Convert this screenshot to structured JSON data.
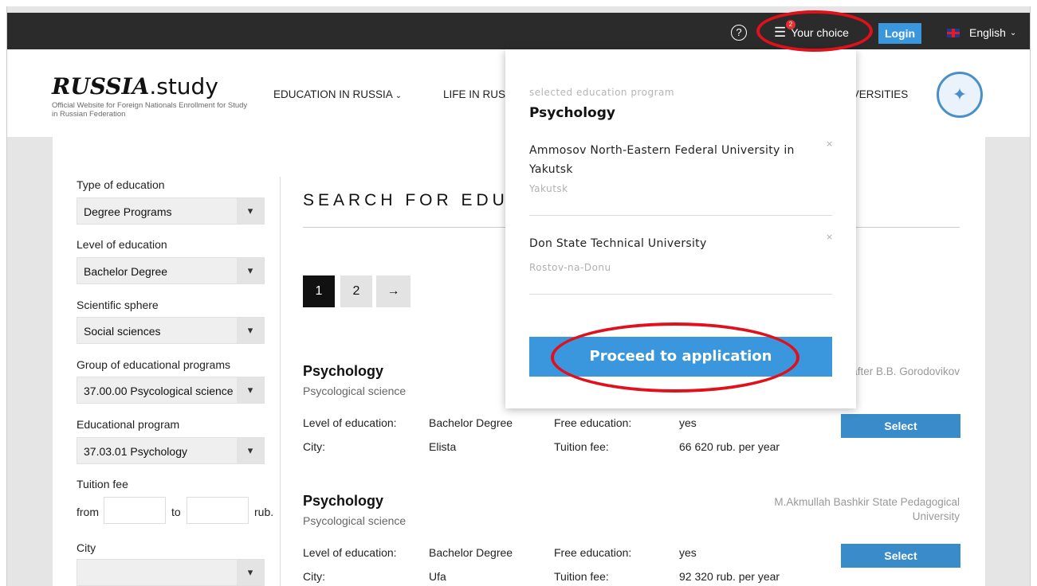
{
  "topbar": {
    "help_icon": "?",
    "choice_label": "Your choice",
    "choice_badge": "2",
    "login_label": "Login",
    "language_label": "English",
    "colors": {
      "bar": "#2b2b2b",
      "login": "#3a96dd",
      "highlight": "#e0111b"
    }
  },
  "header": {
    "logo_text": ".study",
    "logo_mark": "RUSSIA",
    "logo_subtitle": "Official Website for Foreign Nationals Enrollment for Study in Russian Federation",
    "nav": [
      "EDUCATION IN RUSSIA",
      "LIFE IN RUSS",
      "IVERSITIES"
    ]
  },
  "filters": {
    "type_label": "Type of education",
    "type_value": "Degree Programs",
    "level_label": "Level of education",
    "level_value": "Bachelor Degree",
    "sphere_label": "Scientific sphere",
    "sphere_value": "Social sciences",
    "group_label": "Group of educational programs",
    "group_value": "37.00.00 Psycological science",
    "program_label": "Educational program",
    "program_value": "37.03.01 Psychology",
    "fee_label": "Tuition fee",
    "fee_from": "from",
    "fee_to": "to",
    "fee_unit": "rub.",
    "city_label": "City",
    "city_value": ""
  },
  "main": {
    "title": "SEARCH FOR EDU",
    "pages": [
      "1",
      "2"
    ],
    "next_arrow": "→",
    "results": [
      {
        "title": "Psychology",
        "subtitle": "Psycological science",
        "university": "rsity named after B.B. Gorodovikov",
        "level_label": "Level of education:",
        "level_value": "Bachelor Degree",
        "free_label": "Free education:",
        "free_value": "yes",
        "city_label": "City:",
        "city_value": "Elista",
        "fee_label": "Tuition fee:",
        "fee_value": "66 620 rub. per year",
        "select_label": "Select"
      },
      {
        "title": "Psychology",
        "subtitle": "Psycological science",
        "university": "M.Akmullah Bashkir State Pedagogical University",
        "level_label": "Level of education:",
        "level_value": "Bachelor Degree",
        "free_label": "Free education:",
        "free_value": "yes",
        "city_label": "City:",
        "city_value": "Ufa",
        "fee_label": "Tuition fee:",
        "fee_value": "92 320 rub. per year",
        "select_label": "Select"
      }
    ]
  },
  "dropdown": {
    "caption": "selected education program",
    "program": "Psychology",
    "items": [
      {
        "university": "Ammosov North-Eastern Federal University in Yakutsk",
        "city": "Yakutsk",
        "remove": "×"
      },
      {
        "university": "Don State Technical University",
        "city": "Rostov-na-Donu",
        "remove": "×"
      }
    ],
    "proceed_label": "Proceed to application"
  }
}
